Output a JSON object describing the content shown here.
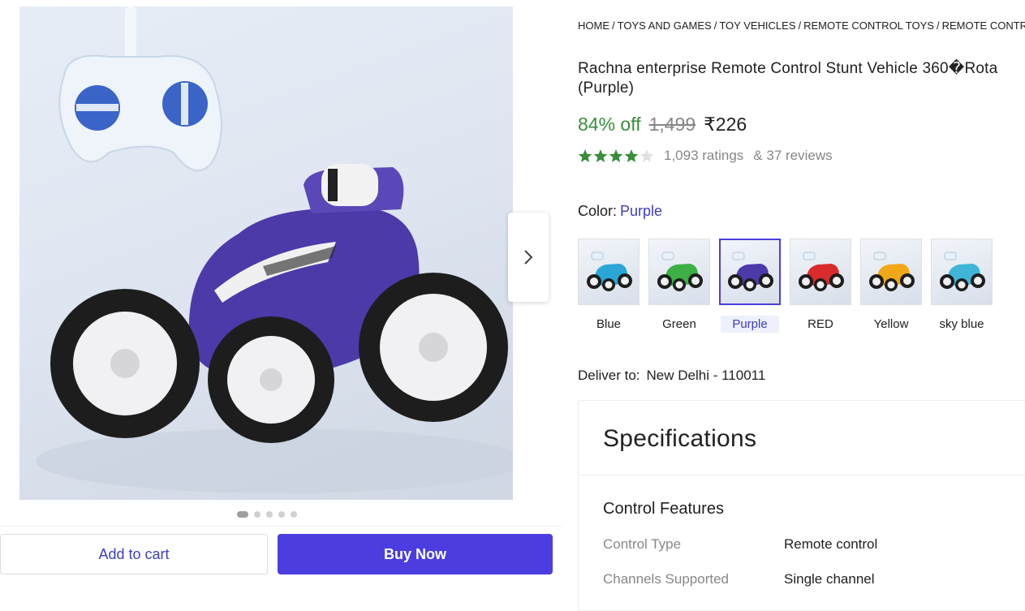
{
  "breadcrumb": [
    "HOME",
    "TOYS AND GAMES",
    "TOY VEHICLES",
    "REMOTE CONTROL TOYS",
    "REMOTE CONTROL"
  ],
  "product": {
    "title_line1": "Rachna enterprise Remote Control Stunt Vehicle 360�Rota",
    "title_line2": "(Purple)",
    "discount": "84% off",
    "mrp": "1,499",
    "price": "₹226",
    "rating_stars": 4,
    "ratings_text": "1,093 ratings",
    "reviews_text": "& 37 reviews"
  },
  "color": {
    "label": "Color:",
    "selected": "Purple",
    "options": [
      {
        "name": "Blue",
        "hex": "#2aa6d6"
      },
      {
        "name": "Green",
        "hex": "#3cb043"
      },
      {
        "name": "Purple",
        "hex": "#4b3aa8"
      },
      {
        "name": "RED",
        "hex": "#d92b2b"
      },
      {
        "name": "Yellow",
        "hex": "#f0a818"
      },
      {
        "name": "sky blue",
        "hex": "#3fb6d8"
      }
    ]
  },
  "delivery": {
    "label": "Deliver to:",
    "location": "New Delhi - 110011"
  },
  "specifications": {
    "title": "Specifications",
    "group": "Control Features",
    "rows": [
      {
        "key": "Control Type",
        "value": "Remote control"
      },
      {
        "key": "Channels Supported",
        "value": "Single channel"
      }
    ]
  },
  "actions": {
    "add_to_cart": "Add to cart",
    "buy_now": "Buy Now"
  },
  "gallery": {
    "image_count": 5,
    "active_index": 0,
    "next_icon": "chevron-right-icon"
  },
  "colors": {
    "accent": "#4b3de0",
    "discount": "#388e3c",
    "star": "#388e3c",
    "muted": "#878787"
  }
}
